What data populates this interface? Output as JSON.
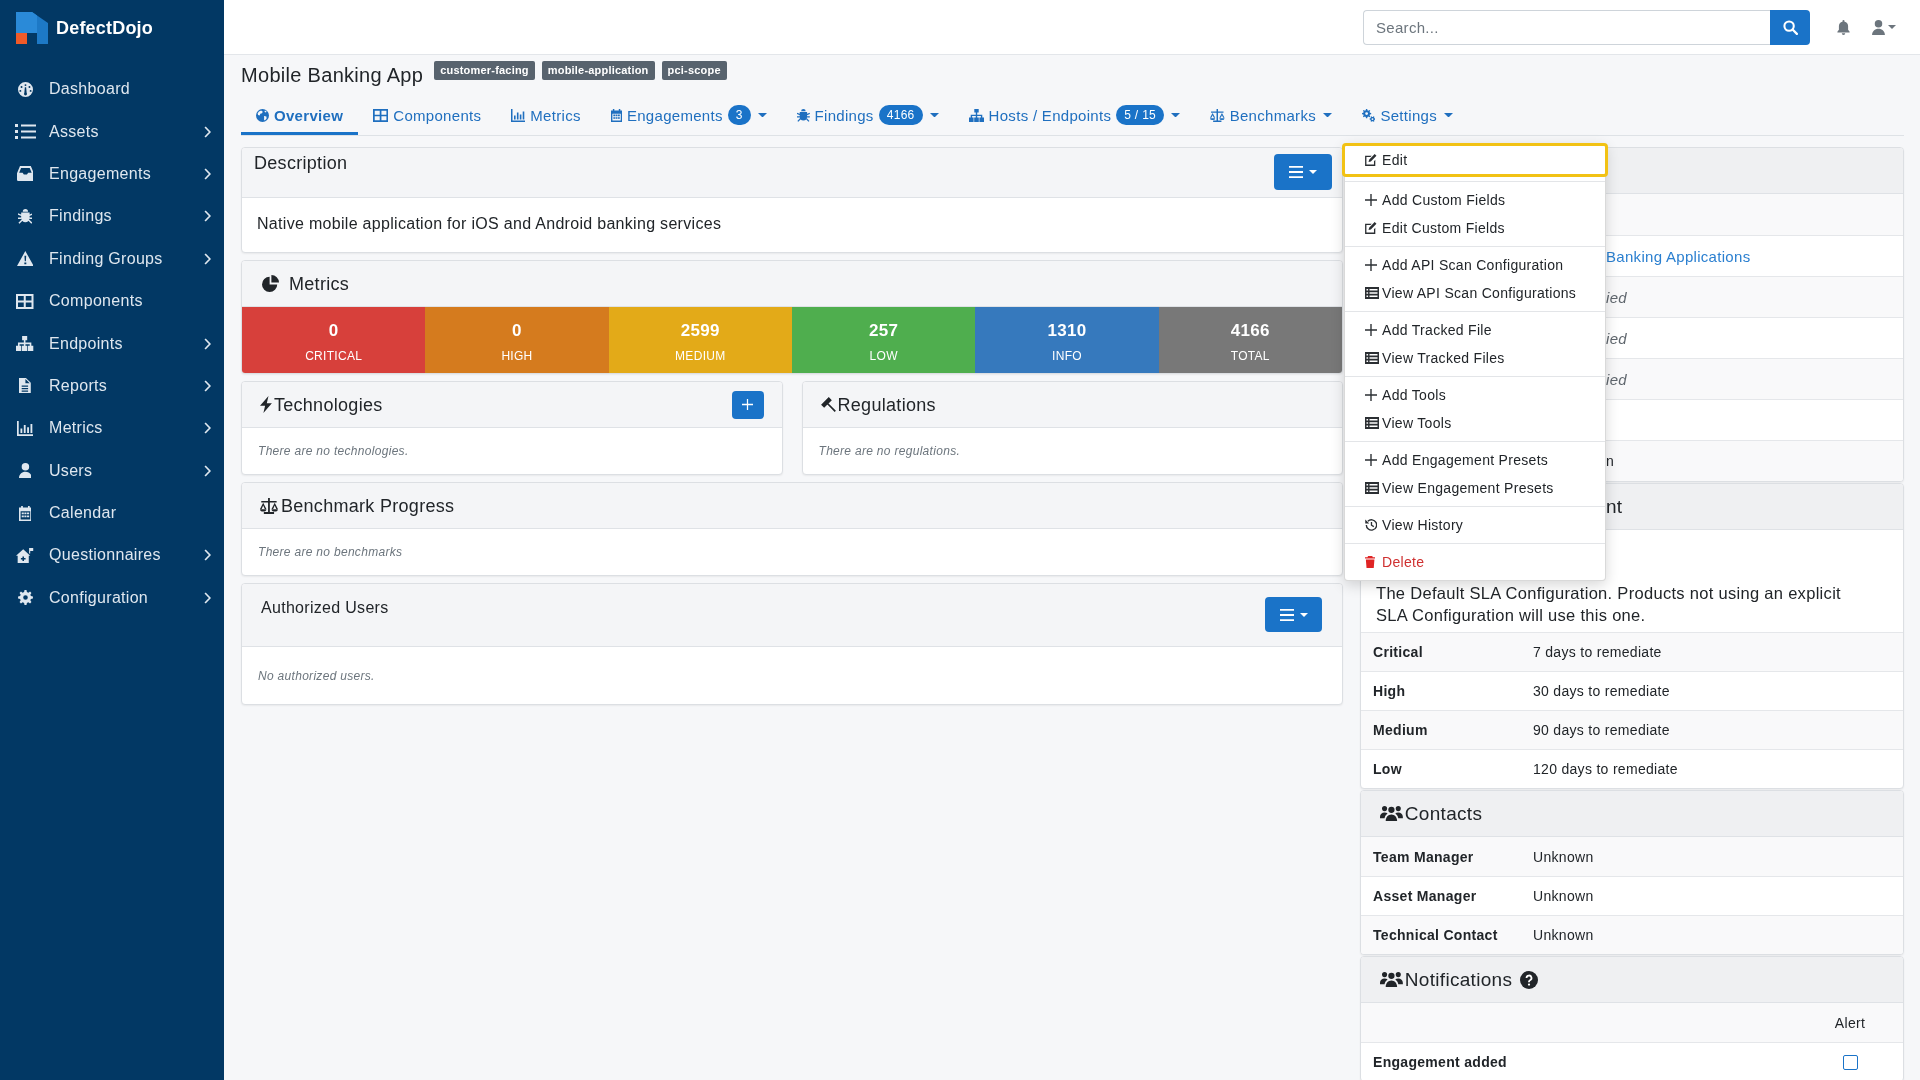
{
  "sidebar": {
    "brand": "DefectDojo",
    "items": [
      {
        "label": "Dashboard",
        "expandable": false
      },
      {
        "label": "Assets",
        "expandable": true
      },
      {
        "label": "Engagements",
        "expandable": true
      },
      {
        "label": "Findings",
        "expandable": true
      },
      {
        "label": "Finding Groups",
        "expandable": true
      },
      {
        "label": "Components",
        "expandable": false
      },
      {
        "label": "Endpoints",
        "expandable": true
      },
      {
        "label": "Reports",
        "expandable": true
      },
      {
        "label": "Metrics",
        "expandable": true
      },
      {
        "label": "Users",
        "expandable": true
      },
      {
        "label": "Calendar",
        "expandable": false
      },
      {
        "label": "Questionnaires",
        "expandable": true
      },
      {
        "label": "Configuration",
        "expandable": true
      }
    ]
  },
  "top_bar": {
    "search": {
      "placeholder": "Search..."
    }
  },
  "asset": {
    "title": "Mobile Banking App",
    "tags": [
      "customer-facing",
      "mobile-application",
      "pci-scope"
    ]
  },
  "tabs": [
    {
      "label": "Overview",
      "selected": true,
      "dropdown": false
    },
    {
      "label": "Components",
      "selected": false,
      "dropdown": false
    },
    {
      "label": "Metrics",
      "selected": false,
      "dropdown": false
    },
    {
      "label": "Engagements",
      "selected": false,
      "badge": "3",
      "dropdown": true
    },
    {
      "label": "Findings",
      "selected": false,
      "badge": "4166",
      "dropdown": true
    },
    {
      "label": "Hosts / Endpoints",
      "selected": false,
      "badge": "5 / 15",
      "dropdown": true
    },
    {
      "label": "Benchmarks",
      "selected": false,
      "dropdown": true
    },
    {
      "label": "Settings",
      "selected": false,
      "dropdown": true,
      "menu": {
        "groups": [
          {
            "items": [
              {
                "label": "Edit",
                "kind": "edit",
                "focused": true
              }
            ]
          },
          {
            "items": [
              {
                "label": "Add Custom Fields",
                "kind": "add",
                "focused": false
              },
              {
                "label": "Edit Custom Fields",
                "kind": "edit",
                "focused": false
              }
            ]
          },
          {
            "items": [
              {
                "label": "Add API Scan Configuration",
                "kind": "add",
                "focused": false
              },
              {
                "label": "View API Scan Configurations",
                "kind": "view",
                "focused": false
              }
            ]
          },
          {
            "items": [
              {
                "label": "Add Tracked File",
                "kind": "add",
                "focused": false
              },
              {
                "label": "View Tracked Files",
                "kind": "view",
                "focused": false
              }
            ]
          },
          {
            "items": [
              {
                "label": "Add Tools",
                "kind": "add",
                "focused": false
              },
              {
                "label": "View Tools",
                "kind": "view",
                "focused": false
              }
            ]
          },
          {
            "items": [
              {
                "label": "Add Engagement Presets",
                "kind": "add",
                "focused": false
              },
              {
                "label": "View Engagement Presets",
                "kind": "view",
                "focused": false
              }
            ]
          },
          {
            "items": [
              {
                "label": "View History",
                "kind": "history",
                "focused": false
              }
            ]
          },
          {
            "items": [
              {
                "label": "Delete",
                "kind": "delete",
                "focused": false
              }
            ]
          }
        ]
      }
    }
  ],
  "description_card": {
    "title": "Description",
    "text": "Native mobile application for iOS and Android banking services"
  },
  "metrics_card": {
    "title": "Metrics",
    "tiles": [
      {
        "value": "0",
        "label": "CRITICAL",
        "color": "#d7403b"
      },
      {
        "value": "0",
        "label": "HIGH",
        "color": "#d57b1e"
      },
      {
        "value": "2599",
        "label": "MEDIUM",
        "color": "#e3aa18"
      },
      {
        "value": "257",
        "label": "LOW",
        "color": "#4fae4e"
      },
      {
        "value": "1310",
        "label": "INFO",
        "color": "#3679bd"
      },
      {
        "value": "4166",
        "label": "TOTAL",
        "color": "#787878"
      }
    ]
  },
  "technologies_card": {
    "title": "Technologies",
    "empty_text": "There are no technologies."
  },
  "regulations_card": {
    "title": "Regulations",
    "empty_text": "There are no regulations."
  },
  "benchmark_card": {
    "title": "Benchmark Progress",
    "empty_text": "There are no benchmarks"
  },
  "authorized_users_card": {
    "title": "Authorized Users",
    "empty_text": "No authorized users."
  },
  "covered_card": {
    "rows": [
      {},
      {
        "value": "Banking Applications",
        "kind": "link"
      },
      {
        "value": "ied",
        "kind": "muted"
      },
      {
        "value": "ied",
        "kind": "muted"
      },
      {
        "value": "ied",
        "kind": "muted"
      },
      {},
      {
        "value": "n",
        "kind": "plain"
      }
    ]
  },
  "sla_card": {
    "title": "nt",
    "text": "The Default SLA Configuration. Products not using an explicit SLA Configuration will use this one.",
    "rows": [
      {
        "label": "Critical",
        "value": "7 days to remediate"
      },
      {
        "label": "High",
        "value": "30 days to remediate"
      },
      {
        "label": "Medium",
        "value": "90 days to remediate"
      },
      {
        "label": "Low",
        "value": "120 days to remediate"
      }
    ]
  },
  "contacts_card": {
    "title": "Contacts",
    "rows": [
      {
        "label": "Team Manager",
        "value": "Unknown"
      },
      {
        "label": "Asset Manager",
        "value": "Unknown"
      },
      {
        "label": "Technical Contact",
        "value": "Unknown"
      }
    ]
  },
  "notifications_card": {
    "title": "Notifications",
    "columns": [
      "Alert"
    ],
    "rows": [
      {
        "label": "Engagement added",
        "checked": false
      }
    ]
  }
}
